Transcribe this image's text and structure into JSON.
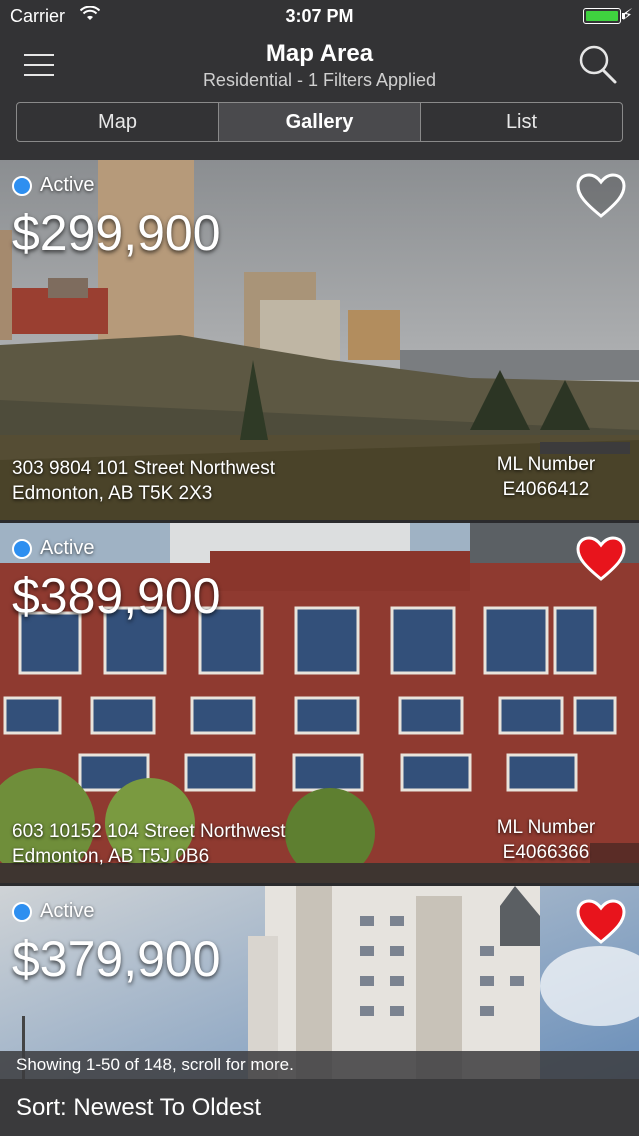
{
  "status_bar": {
    "carrier": "Carrier",
    "time": "3:07 PM"
  },
  "header": {
    "title": "Map Area",
    "subtitle": "Residential - 1 Filters Applied",
    "tabs": [
      {
        "label": "Map",
        "active": false
      },
      {
        "label": "Gallery",
        "active": true
      },
      {
        "label": "List",
        "active": false
      }
    ]
  },
  "listings": [
    {
      "status": "Active",
      "price": "$299,900",
      "address_line1": "303 9804 101 Street Northwest",
      "address_line2": "Edmonton, AB T5K 2X3",
      "ml_label": "ML Number",
      "ml_number": "E4066412",
      "favorited": false
    },
    {
      "status": "Active",
      "price": "$389,900",
      "address_line1": "603 10152 104 Street Northwest",
      "address_line2": "Edmonton, AB T5J 0B6",
      "ml_label": "ML Number",
      "ml_number": "E4066366",
      "favorited": true
    },
    {
      "status": "Active",
      "price": "$379,900",
      "favorited": true
    }
  ],
  "footer": {
    "showing": "Showing 1-50 of 148, scroll for more.",
    "sort": "Sort: Newest To Oldest"
  },
  "colors": {
    "header_bg": "#333335",
    "status_dot": "#2e8ff0",
    "favorite_red": "#e8141c",
    "battery_green": "#3fd23f"
  }
}
